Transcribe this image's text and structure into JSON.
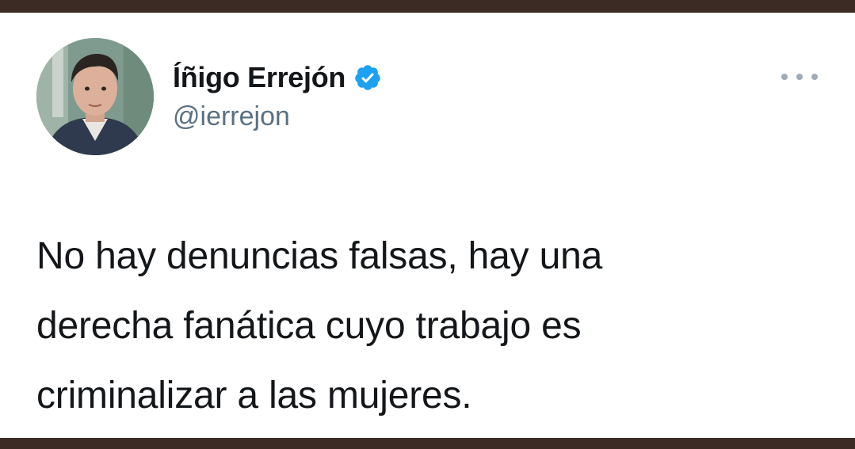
{
  "tweet": {
    "author": {
      "display_name": "Íñigo Errejón",
      "handle": "@ierrejon",
      "verified": true,
      "verified_color": "#1da1f2",
      "avatar_icon": "avatar-photo"
    },
    "more_icon": "more-options-icon",
    "text_lines": [
      "No hay denuncias falsas, hay una",
      "derecha fanática cuyo trabajo es",
      "criminalizar a las mujeres."
    ]
  }
}
